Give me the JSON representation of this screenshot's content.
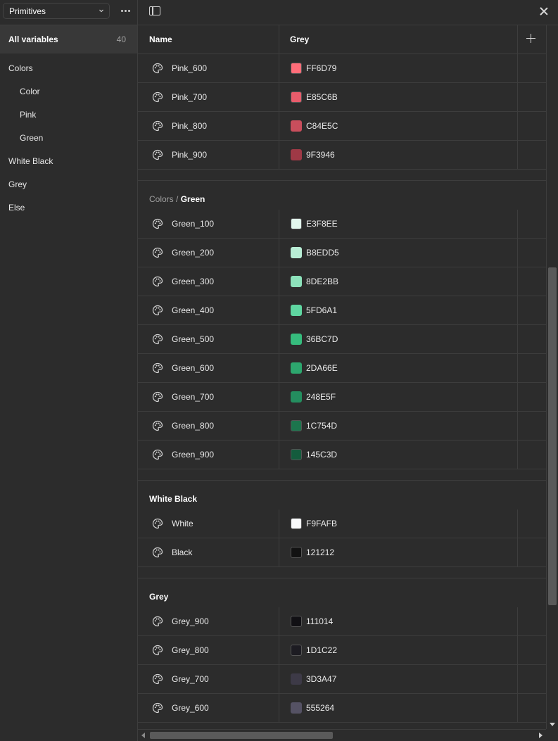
{
  "collection": {
    "name": "Primitives",
    "chevron_icon": "chevron-down-icon",
    "more_icon": "more-horizontal-icon"
  },
  "sidebar": {
    "all_variables": {
      "label": "All variables",
      "count": "40"
    },
    "groups": [
      {
        "label": "Colors",
        "level": 0
      },
      {
        "label": "Color",
        "level": 1
      },
      {
        "label": "Pink",
        "level": 1
      },
      {
        "label": "Green",
        "level": 1
      },
      {
        "label": "White Black",
        "level": 0
      },
      {
        "label": "Grey",
        "level": 0
      },
      {
        "label": "Else",
        "level": 0
      }
    ]
  },
  "toolbar": {
    "sidebar_toggle_icon": "sidebar-toggle-icon",
    "close_icon": "close-icon"
  },
  "table": {
    "headers": {
      "name": "Name",
      "mode": "Grey",
      "add_icon": "plus-icon"
    },
    "sections": [
      {
        "title_prefix": "",
        "title": "",
        "rows": [
          {
            "name": "Pink_600",
            "hex": "FF6D79",
            "color": "#FF6D79"
          },
          {
            "name": "Pink_700",
            "hex": "E85C6B",
            "color": "#E85C6B"
          },
          {
            "name": "Pink_800",
            "hex": "C84E5C",
            "color": "#C84E5C"
          },
          {
            "name": "Pink_900",
            "hex": "9F3946",
            "color": "#9F3946"
          }
        ]
      },
      {
        "title_prefix": "Colors / ",
        "title": "Green",
        "rows": [
          {
            "name": "Green_100",
            "hex": "E3F8EE",
            "color": "#E3F8EE"
          },
          {
            "name": "Green_200",
            "hex": "B8EDD5",
            "color": "#B8EDD5"
          },
          {
            "name": "Green_300",
            "hex": "8DE2BB",
            "color": "#8DE2BB"
          },
          {
            "name": "Green_400",
            "hex": "5FD6A1",
            "color": "#5FD6A1"
          },
          {
            "name": "Green_500",
            "hex": "36BC7D",
            "color": "#36BC7D"
          },
          {
            "name": "Green_600",
            "hex": "2DA66E",
            "color": "#2DA66E"
          },
          {
            "name": "Green_700",
            "hex": "248E5F",
            "color": "#248E5F"
          },
          {
            "name": "Green_800",
            "hex": "1C754D",
            "color": "#1C754D"
          },
          {
            "name": "Green_900",
            "hex": "145C3D",
            "color": "#145C3D"
          }
        ]
      },
      {
        "title_prefix": "",
        "title": "White Black",
        "rows": [
          {
            "name": "White",
            "hex": "F9FAFB",
            "color": "#F9FAFB"
          },
          {
            "name": "Black",
            "hex": "121212",
            "color": "#121212"
          }
        ]
      },
      {
        "title_prefix": "",
        "title": "Grey",
        "rows": [
          {
            "name": "Grey_900",
            "hex": "111014",
            "color": "#111014"
          },
          {
            "name": "Grey_800",
            "hex": "1D1C22",
            "color": "#1D1C22"
          },
          {
            "name": "Grey_700",
            "hex": "3D3A47",
            "color": "#3D3A47"
          },
          {
            "name": "Grey_600",
            "hex": "555264",
            "color": "#555264"
          }
        ]
      }
    ]
  }
}
